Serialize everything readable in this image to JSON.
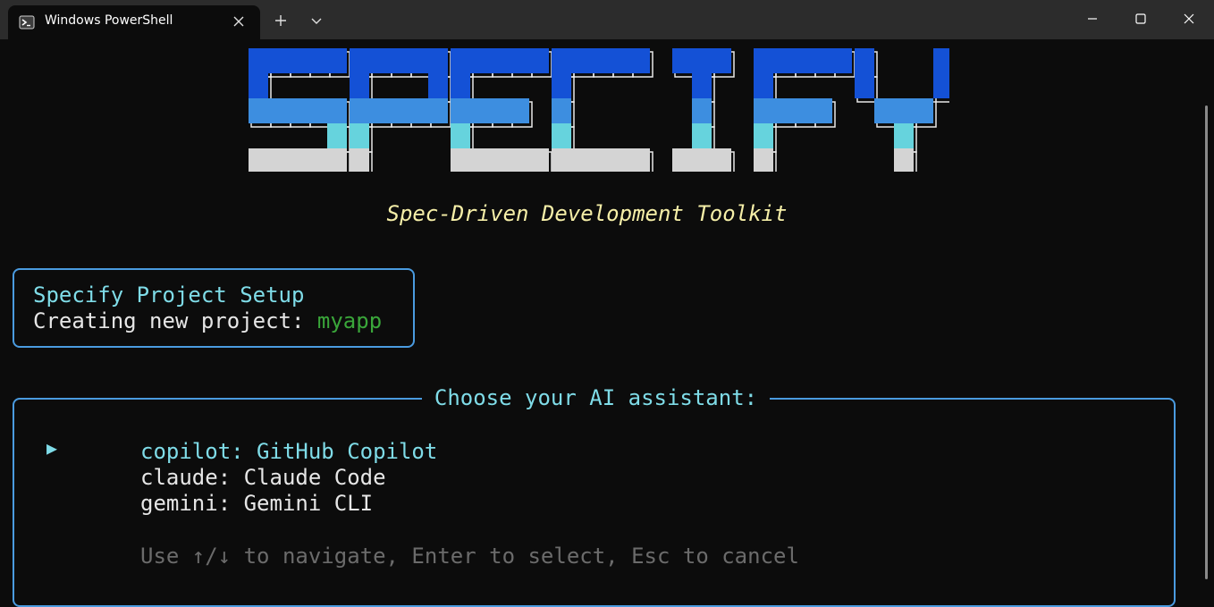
{
  "window": {
    "tab_title": "Windows PowerShell"
  },
  "icons": {
    "tab": "powershell-icon",
    "tab_close": "close-icon",
    "new_tab": "plus-icon",
    "tab_dropdown": "chevron-down-icon",
    "minimize": "minimize-icon",
    "maximize": "maximize-icon",
    "close": "close-icon"
  },
  "terminal": {
    "banner_text": "SPECIFY",
    "tagline": "Spec-Driven Development Toolkit",
    "setup": {
      "title": "Specify Project Setup",
      "creating_label": "Creating new project: ",
      "project_name": "myapp"
    },
    "selector": {
      "title": "Choose your AI assistant:",
      "pointer": "▶",
      "options": [
        "copilot: GitHub Copilot",
        "claude: Claude Code",
        "gemini: Gemini CLI"
      ],
      "selected_index": 0,
      "hint": "Use ↑/↓ to navigate, Enter to select, Esc to cancel"
    }
  },
  "colors": {
    "background": "#0c0c0c",
    "titlebar": "#2c2c2c",
    "accent_cyan": "#7fdce8",
    "border_blue": "#4a9be0",
    "tagline_yellow": "#f6efa8",
    "project_green": "#3aa63a",
    "hint_gray": "#6b6b6b",
    "banner_rows": [
      "#1451d6",
      "#3d8ee0",
      "#66d3dd",
      "#d4d4d4"
    ]
  }
}
